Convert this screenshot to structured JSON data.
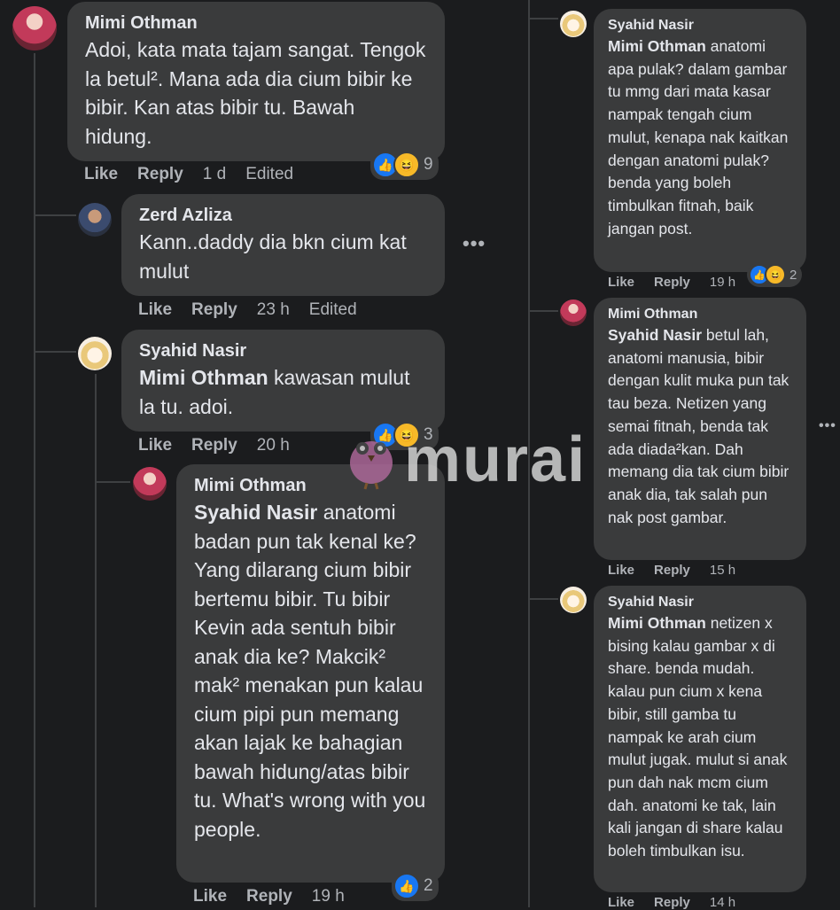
{
  "left": {
    "comments": [
      {
        "name": "Mimi Othman",
        "text": "Adoi, kata mata tajam sangat. Tengok la betul². Mana ada dia cium bibir ke bibir. Kan atas bibir tu. Bawah hidung.",
        "like": "Like",
        "reply": "Reply",
        "time": "1 d",
        "status": "Edited",
        "reaction_count": "9"
      },
      {
        "name": "Zerd Azliza",
        "text": "Kann..daddy dia bkn cium kat mulut",
        "like": "Like",
        "reply": "Reply",
        "time": "23 h",
        "status": "Edited"
      },
      {
        "name": "Syahid Nasir",
        "mention": "Mimi Othman",
        "text": " kawasan mulut la tu. adoi.",
        "like": "Like",
        "reply": "Reply",
        "time": "20 h",
        "reaction_count": "3"
      },
      {
        "name": "Mimi Othman",
        "mention": "Syahid Nasir",
        "text": " anatomi badan pun tak kenal ke? Yang dilarang cium bibir bertemu bibir. Tu bibir Kevin ada sentuh bibir anak dia ke? Makcik² mak² menakan pun kalau cium pipi pun memang akan lajak ke bahagian bawah hidung/atas bibir tu. What's wrong with you people.",
        "like": "Like",
        "reply": "Reply",
        "time": "19 h",
        "reaction_count": "2"
      }
    ],
    "more_icon": "•••"
  },
  "right": {
    "comments": [
      {
        "name": "Syahid Nasir",
        "mention": "Mimi Othman",
        "text": " anatomi apa pulak? dalam gambar tu mmg dari mata kasar nampak tengah cium mulut, kenapa nak kaitkan dengan anatomi pulak? benda yang boleh timbulkan fitnah, baik jangan post.",
        "like": "Like",
        "reply": "Reply",
        "time": "19 h",
        "reaction_count": "2"
      },
      {
        "name": "Mimi Othman",
        "mention": "Syahid Nasir",
        "text": " betul lah, anatomi manusia, bibir dengan kulit muka pun tak tau beza. Netizen yang semai fitnah, benda tak ada diada²kan. Dah memang dia tak cium bibir anak dia, tak salah pun nak post gambar.",
        "like": "Like",
        "reply": "Reply",
        "time": "15 h"
      },
      {
        "name": "Syahid Nasir",
        "mention": "Mimi Othman",
        "text": " netizen x bising kalau gambar x di share. benda mudah. kalau pun cium x kena bibir, still gamba tu nampak ke arah cium mulut jugak. mulut si anak pun dah nak mcm cium dah. anatomi ke tak, lain kali jangan di share kalau boleh timbulkan isu.",
        "like": "Like",
        "reply": "Reply",
        "time": "14 h"
      }
    ],
    "more_icon": "•••"
  },
  "watermark": {
    "text": "murai"
  },
  "icons": {
    "like": "like-reaction-icon",
    "haha": "haha-reaction-icon"
  },
  "colors": {
    "background": "#1b1c1e",
    "bubble": "#3a3b3c",
    "text": "#e4e6eb",
    "muted": "#b0b3b8",
    "like": "#1877f2",
    "haha": "#f7b928"
  }
}
